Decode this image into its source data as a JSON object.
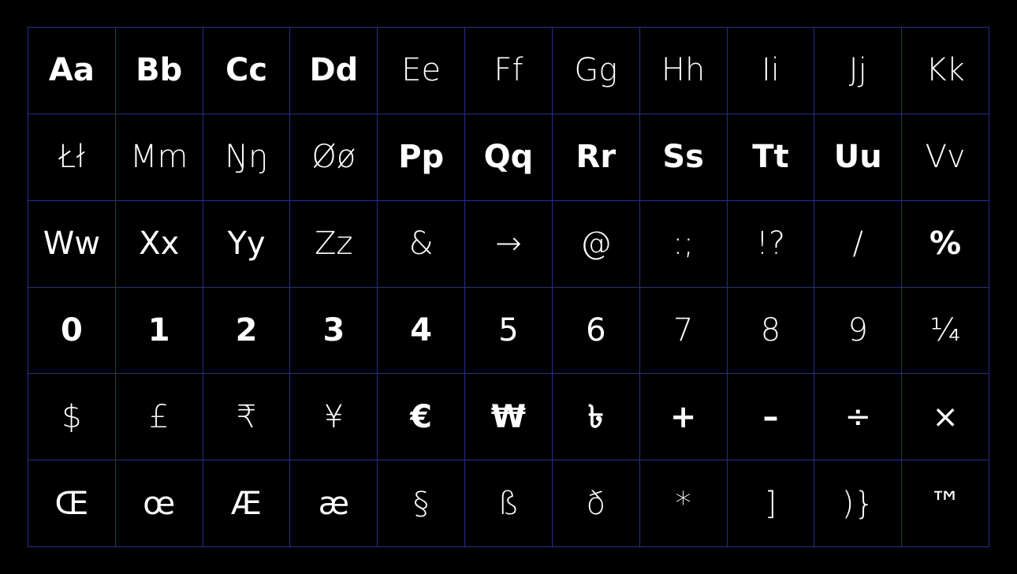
{
  "specimen": {
    "rows": [
      [
        {
          "text": "Aa",
          "weight": "bold"
        },
        {
          "text": "Bb",
          "weight": "bold"
        },
        {
          "text": "Cc",
          "weight": "bold"
        },
        {
          "text": "Dd",
          "weight": "bold"
        },
        {
          "text": "Ee",
          "weight": "light"
        },
        {
          "text": "Ff",
          "weight": "light"
        },
        {
          "text": "Gg",
          "weight": "light"
        },
        {
          "text": "Hh",
          "weight": "light"
        },
        {
          "text": "Ii",
          "weight": "thin"
        },
        {
          "text": "Jj",
          "weight": "thin"
        },
        {
          "text": "Kk",
          "weight": "thin"
        }
      ],
      [
        {
          "text": "Łł",
          "weight": "thin"
        },
        {
          "text": "Mm",
          "weight": "thin"
        },
        {
          "text": "Ŋŋ",
          "weight": "thin"
        },
        {
          "text": "Øø",
          "weight": "thin"
        },
        {
          "text": "Pp",
          "weight": "bold"
        },
        {
          "text": "Qq",
          "weight": "bold"
        },
        {
          "text": "Rr",
          "weight": "bold"
        },
        {
          "text": "Ss",
          "weight": "bold"
        },
        {
          "text": "Tt",
          "weight": "bold"
        },
        {
          "text": "Uu",
          "weight": "bold"
        },
        {
          "text": "Vv",
          "weight": "light"
        }
      ],
      [
        {
          "text": "Ww",
          "weight": "normal"
        },
        {
          "text": "Xx",
          "weight": "normal"
        },
        {
          "text": "Yy",
          "weight": "normal"
        },
        {
          "text": "Zz",
          "weight": "thin"
        },
        {
          "text": "&",
          "weight": "thin"
        },
        {
          "text": "→",
          "weight": "thin"
        },
        {
          "text": "@",
          "weight": "thin"
        },
        {
          "text": ":;",
          "weight": "thin"
        },
        {
          "text": "!?",
          "weight": "thin"
        },
        {
          "text": "/",
          "weight": "thin"
        },
        {
          "text": "%",
          "weight": "bold"
        }
      ],
      [
        {
          "text": "0",
          "weight": "bold"
        },
        {
          "text": "1",
          "weight": "bold"
        },
        {
          "text": "2",
          "weight": "bold"
        },
        {
          "text": "3",
          "weight": "bold"
        },
        {
          "text": "4",
          "weight": "bold"
        },
        {
          "text": "5",
          "weight": "normal"
        },
        {
          "text": "6",
          "weight": "normal"
        },
        {
          "text": "7",
          "weight": "light"
        },
        {
          "text": "8",
          "weight": "light"
        },
        {
          "text": "9",
          "weight": "thin"
        },
        {
          "text": "¼",
          "weight": "thin"
        }
      ],
      [
        {
          "text": "$",
          "weight": "thin"
        },
        {
          "text": "£",
          "weight": "thin"
        },
        {
          "text": "₹",
          "weight": "thin"
        },
        {
          "text": "¥",
          "weight": "thin"
        },
        {
          "text": "€",
          "weight": "bold"
        },
        {
          "text": "₩",
          "weight": "bold"
        },
        {
          "text": "৳",
          "weight": "bold"
        },
        {
          "text": "+",
          "weight": "bold"
        },
        {
          "text": "–",
          "weight": "bold"
        },
        {
          "text": "÷",
          "weight": "normal"
        },
        {
          "text": "×",
          "weight": "normal"
        }
      ],
      [
        {
          "text": "Œ",
          "weight": "normal"
        },
        {
          "text": "œ",
          "weight": "normal"
        },
        {
          "text": "Æ",
          "weight": "normal"
        },
        {
          "text": "æ",
          "weight": "normal"
        },
        {
          "text": "§",
          "weight": "thin"
        },
        {
          "text": "ß",
          "weight": "thin"
        },
        {
          "text": "ð",
          "weight": "thin"
        },
        {
          "text": "*",
          "weight": "thin"
        },
        {
          "text": "]",
          "weight": "thin"
        },
        {
          "text": ")}",
          "weight": "thin"
        },
        {
          "text": "™",
          "weight": "normal"
        }
      ]
    ],
    "colors": {
      "background": "#000000",
      "grid_line": "#2a2f8a",
      "glyph": "#ffffff"
    }
  }
}
